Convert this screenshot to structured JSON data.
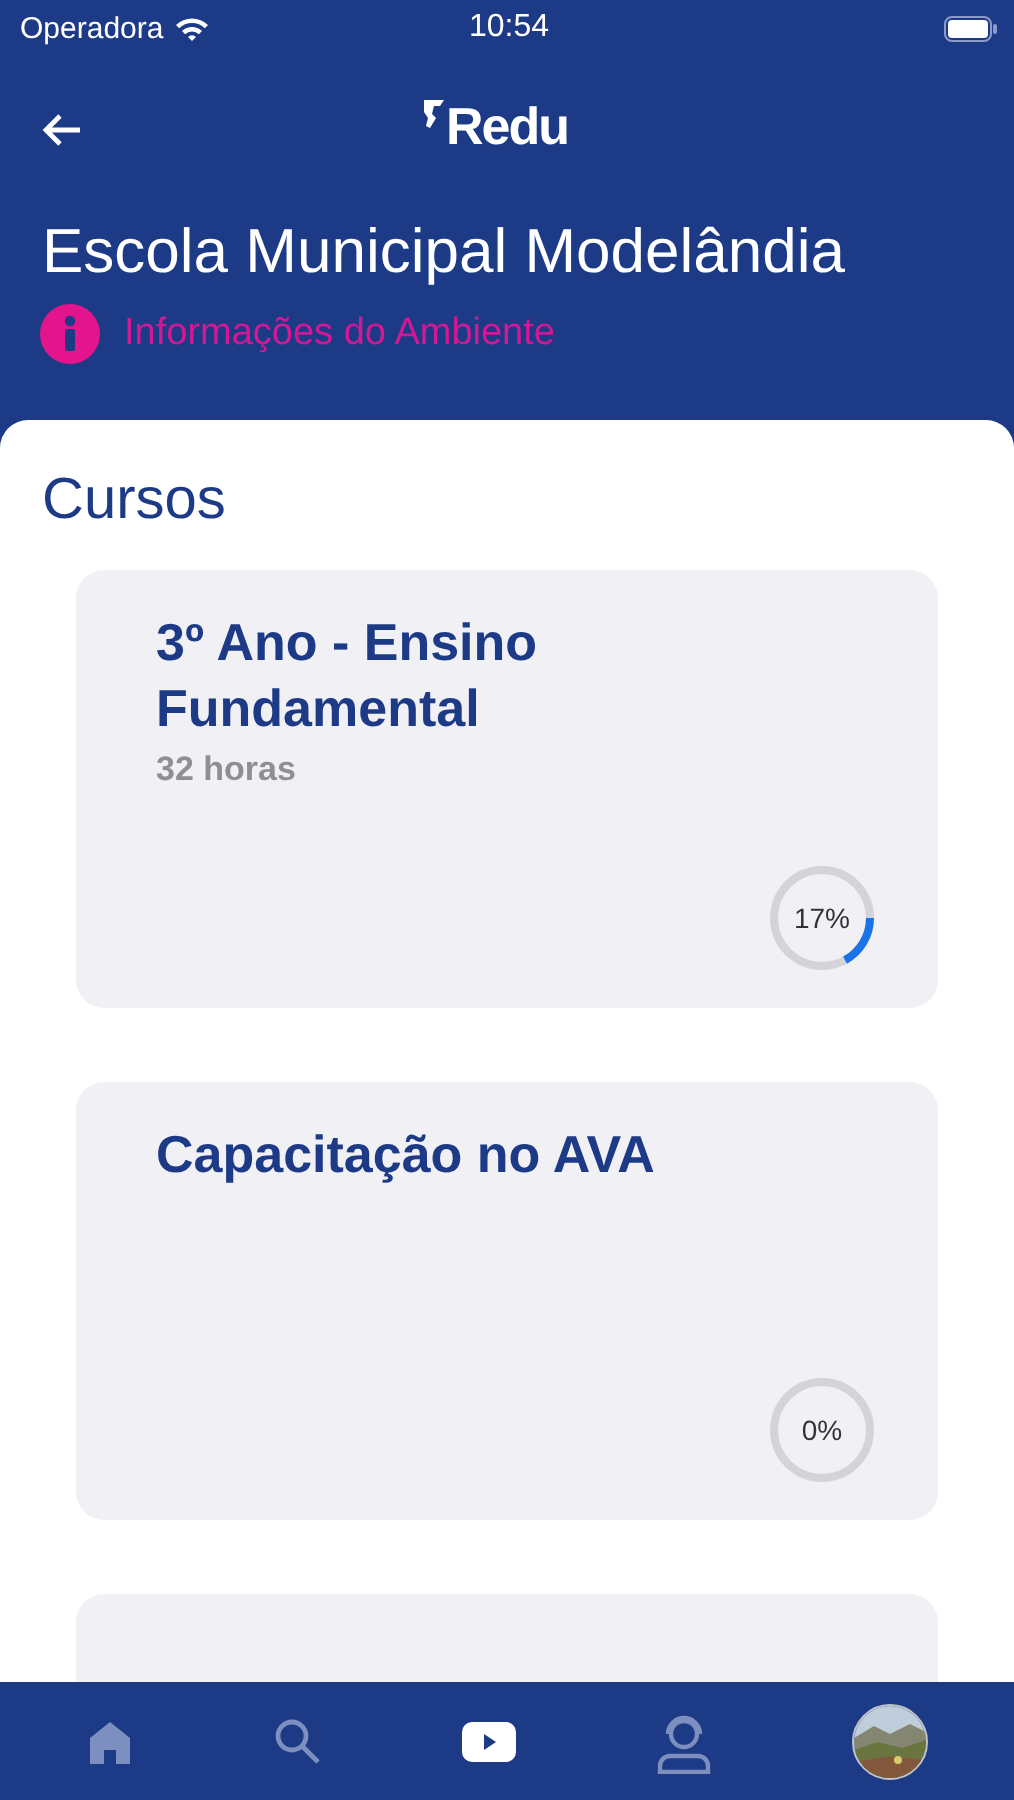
{
  "status_bar": {
    "carrier": "Operadora",
    "time": "10:54"
  },
  "header": {
    "logo": "Redu",
    "title": "Escola Municipal Modelândia",
    "info_link": "Informações do Ambiente"
  },
  "section_title": "Cursos",
  "courses": [
    {
      "title": "3º Ano - Ensino Fundamental",
      "hours": "32 horas",
      "reading": "17%"
    },
    {
      "title": "Capacitação no AVA",
      "reading": "0%"
    }
  ],
  "tab_bar": [
    {
      "kind": "home",
      "selected": false
    },
    {
      "kind": "search",
      "selected": false
    },
    {
      "kind": "video",
      "selected": true
    },
    {
      "kind": "support",
      "selected": false
    },
    {
      "kind": "avatar",
      "selected": false
    }
  ]
}
